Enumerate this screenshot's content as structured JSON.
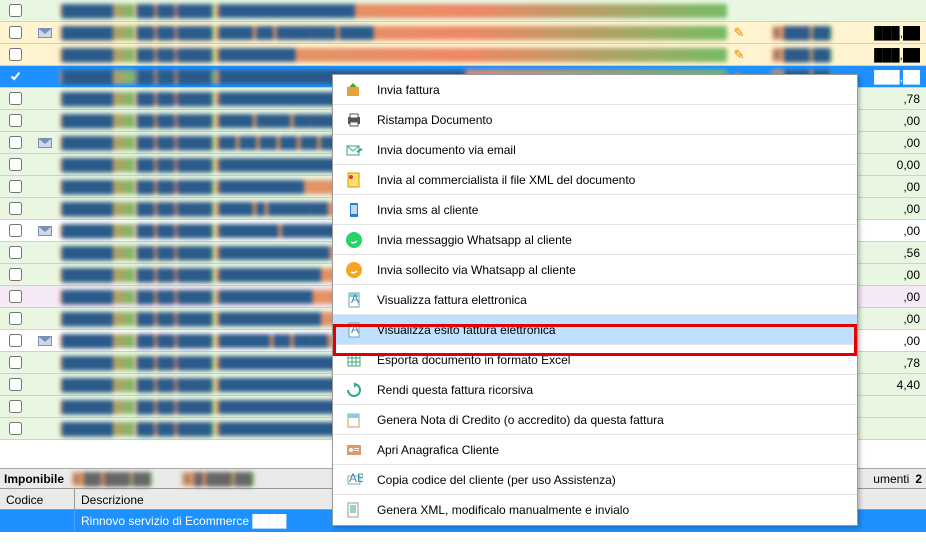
{
  "rows": [
    {
      "bg": "g",
      "env": false,
      "code": "██████",
      "date": "██/██/████",
      "desc": "████████████████",
      "ico": false,
      "amt1": "",
      "amt2": ""
    },
    {
      "bg": "y",
      "env": true,
      "code": "██████",
      "date": "██/██/████",
      "desc": "████ ██ ███████ ████",
      "ico": true,
      "amt1": "€ ███,██",
      "amt2": "███,██"
    },
    {
      "bg": "y",
      "env": false,
      "code": "██████",
      "date": "██/██/████",
      "desc": "█████████",
      "ico": true,
      "amt1": "€ ███,██",
      "amt2": "███,██"
    },
    {
      "sel": true,
      "bg": "",
      "env": false,
      "code": "██████",
      "date": "██/██/████",
      "desc": "█████████████████████████████",
      "ico": true,
      "amt1": "€ ███,██",
      "amt2": "███,██"
    },
    {
      "bg": "g",
      "env": false,
      "code": "██████",
      "date": "██/██/████",
      "desc": "████████████████",
      "ico": false,
      "amt1": "",
      "amt2": ",78"
    },
    {
      "bg": "g",
      "env": false,
      "code": "██████",
      "date": "██/██/████",
      "desc": "████ ████ ████████",
      "ico": false,
      "amt1": "",
      "amt2": ",00"
    },
    {
      "bg": "g",
      "env": true,
      "code": "██████",
      "date": "██/██/████",
      "desc": "██ ██ ██ ██ ██ ██",
      "ico": false,
      "amt1": "",
      "amt2": ",00"
    },
    {
      "bg": "g",
      "env": false,
      "code": "██████",
      "date": "██/██/████",
      "desc": "██████████████████████",
      "ico": false,
      "amt1": "",
      "amt2": "0,00"
    },
    {
      "bg": "g",
      "env": false,
      "code": "██████",
      "date": "██/██/████",
      "desc": "██████████",
      "ico": false,
      "amt1": "",
      "amt2": ",00"
    },
    {
      "bg": "g",
      "env": false,
      "code": "██████",
      "date": "██/██/████",
      "desc": "████ █ ███████",
      "ico": false,
      "amt1": "",
      "amt2": ",00"
    },
    {
      "bg": "w",
      "env": true,
      "code": "██████",
      "date": "██/██/████",
      "desc": "███████ ████████",
      "ico": false,
      "amt1": "",
      "amt2": ",00"
    },
    {
      "bg": "g",
      "env": false,
      "code": "██████",
      "date": "██/██/████",
      "desc": "█████████████",
      "ico": false,
      "amt1": "",
      "amt2": ",56"
    },
    {
      "bg": "g",
      "env": false,
      "code": "██████",
      "date": "██/██/████",
      "desc": "████████████",
      "ico": false,
      "amt1": "",
      "amt2": ",00"
    },
    {
      "bg": "p",
      "env": false,
      "code": "██████",
      "date": "██/██/████",
      "desc": "███████████",
      "ico": false,
      "amt1": "",
      "amt2": ",00"
    },
    {
      "bg": "g",
      "env": false,
      "code": "██████",
      "date": "██/██/████",
      "desc": "████████████",
      "ico": false,
      "amt1": "",
      "amt2": ",00"
    },
    {
      "bg": "w",
      "env": true,
      "code": "██████",
      "date": "██/██/████",
      "desc": "██████ ██ ████",
      "ico": false,
      "amt1": "",
      "amt2": ",00"
    },
    {
      "bg": "g",
      "env": false,
      "code": "██████",
      "date": "██/██/████",
      "desc": "██████████████",
      "ico": false,
      "amt1": "",
      "amt2": ",78"
    },
    {
      "bg": "g",
      "env": false,
      "code": "██████",
      "date": "██/██/████",
      "desc": "██████████████",
      "ico": false,
      "amt1": "",
      "amt2": "4,40"
    },
    {
      "bg": "g",
      "env": false,
      "code": "██████",
      "date": "██/██/████",
      "desc": "██████████████",
      "ico": false,
      "amt1": "",
      "amt2": ""
    },
    {
      "bg": "g",
      "env": false,
      "code": "██████",
      "date": "██/██/████",
      "desc": "██████████████",
      "ico": false,
      "amt1": "",
      "amt2": ""
    }
  ],
  "menu": [
    {
      "icon": "send",
      "label": "Invia fattura"
    },
    {
      "icon": "print",
      "label": "Ristampa Documento"
    },
    {
      "icon": "mail",
      "label": "Invia documento via email"
    },
    {
      "icon": "xml",
      "label": "Invia al commercialista il file XML del documento"
    },
    {
      "icon": "sms",
      "label": "Invia sms al cliente"
    },
    {
      "icon": "wa",
      "label": "Invia messaggio Whatsapp al cliente"
    },
    {
      "icon": "wa2",
      "label": "Invia sollecito via Whatsapp al cliente"
    },
    {
      "icon": "doc",
      "label": "Visualizza fattura elettronica"
    },
    {
      "icon": "doc2",
      "label": "Visualizza esito fattura elettronica",
      "hover": true
    },
    {
      "icon": "xls",
      "label": "Esporta documento in formato Excel"
    },
    {
      "icon": "rec",
      "label": "Rendi questa fattura ricorsiva"
    },
    {
      "icon": "credit",
      "label": "Genera Nota di Credito (o accredito) da questa fattura"
    },
    {
      "icon": "user",
      "label": "Apri Anagrafica Cliente"
    },
    {
      "icon": "copy",
      "label": "Copia codice del cliente (per uso Assistenza)"
    },
    {
      "icon": "xml2",
      "label": "Genera XML, modificalo manualmente e invialo"
    }
  ],
  "footer": {
    "imponibile_label": "Imponibile",
    "imponibile_value": "€ ██.███,██",
    "iva_value": "€ █.███,██",
    "documenti_label": "umenti",
    "documenti_n": "2",
    "col_codice": "Codice",
    "col_descrizione": "Descrizione",
    "data_row": "Rinnovo servizio di Ecommerce ████"
  }
}
